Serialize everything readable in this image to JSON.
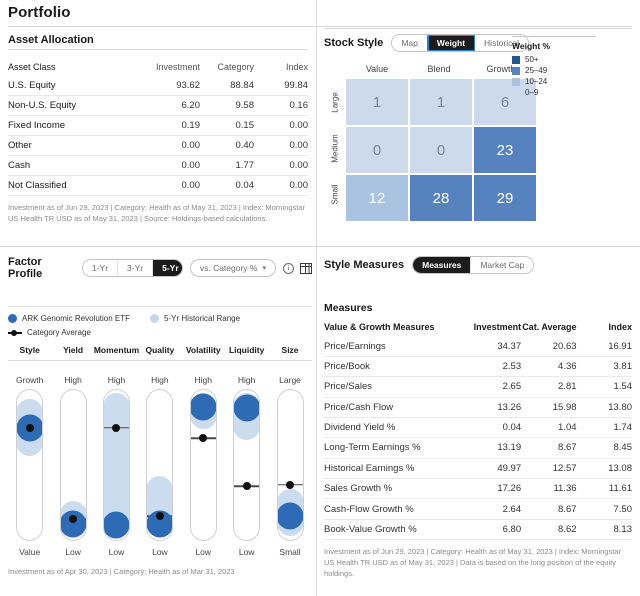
{
  "page": {
    "title": "Portfolio"
  },
  "asset_allocation": {
    "heading": "Asset Allocation",
    "columns": [
      "Asset Class",
      "Investment",
      "Category",
      "Index"
    ],
    "rows": [
      {
        "label": "U.S. Equity",
        "investment": "93.62",
        "category": "88.84",
        "index": "99.84"
      },
      {
        "label": "Non-U.S. Equity",
        "investment": "6.20",
        "category": "9.58",
        "index": "0.16"
      },
      {
        "label": "Fixed Income",
        "investment": "0.19",
        "category": "0.15",
        "index": "0.00"
      },
      {
        "label": "Other",
        "investment": "0.00",
        "category": "0.40",
        "index": "0.00"
      },
      {
        "label": "Cash",
        "investment": "0.00",
        "category": "1.77",
        "index": "0.00"
      },
      {
        "label": "Not Classified",
        "investment": "0.00",
        "category": "0.04",
        "index": "0.00"
      }
    ],
    "footnote": "Investment as of Jun 29, 2023 | Category: Health as of May 31, 2023 | Index: Morningstar US Health TR USD as of May 31, 2023 | Source: Holdings-based calculations."
  },
  "stock_style": {
    "heading": "Stock Style",
    "tabs": [
      {
        "label": "Map",
        "active": false
      },
      {
        "label": "Weight",
        "active": true
      },
      {
        "label": "Historical",
        "active": false
      }
    ],
    "col_headers": [
      "Value",
      "Blend",
      "Growth"
    ],
    "row_headers": [
      "Large",
      "Medium",
      "Small"
    ],
    "cells": [
      [
        {
          "value": "1",
          "band": 0
        },
        {
          "value": "1",
          "band": 0
        },
        {
          "value": "6",
          "band": 0
        }
      ],
      [
        {
          "value": "0",
          "band": 0
        },
        {
          "value": "0",
          "band": 0
        },
        {
          "value": "23",
          "band": 2
        }
      ],
      [
        {
          "value": "12",
          "band": 1
        },
        {
          "value": "28",
          "band": 2
        },
        {
          "value": "29",
          "band": 2
        }
      ]
    ],
    "legend": {
      "title": "Weight %",
      "items": [
        {
          "label": "50+",
          "color": "#23558f"
        },
        {
          "label": "25–49",
          "color": "#5782c0"
        },
        {
          "label": "10–24",
          "color": "#a9c3e0"
        },
        {
          "label": "0–9",
          "color": "#ccdaeb"
        }
      ]
    }
  },
  "factor_profile": {
    "heading": "Factor Profile",
    "period_tabs": [
      {
        "label": "1-Yr",
        "active": false
      },
      {
        "label": "3-Yr",
        "active": false
      },
      {
        "label": "5-Yr",
        "active": true
      }
    ],
    "comparison": {
      "label": "vs. Category %",
      "caret": "⌄"
    },
    "info_icon": "i",
    "legend": [
      {
        "label": "ARK Genomic Revolution ETF",
        "marker": "blue-dot"
      },
      {
        "label": "5-Yr Historical Range",
        "marker": "light-dot"
      },
      {
        "label": "Category Average",
        "marker": "line-dot"
      }
    ],
    "factors": [
      {
        "name": "Style",
        "top": "Growth",
        "bottom": "Value",
        "value_pct": 25,
        "range_top_pct": 6,
        "range_bottom_pct": 44,
        "avg_pct": 25
      },
      {
        "name": "Yield",
        "top": "High",
        "bottom": "Low",
        "value_pct": 89,
        "range_top_pct": 74,
        "range_bottom_pct": 97,
        "avg_pct": 86
      },
      {
        "name": "Momentum",
        "top": "High",
        "bottom": "Low",
        "value_pct": 90,
        "range_top_pct": 2,
        "range_bottom_pct": 98,
        "avg_pct": 25
      },
      {
        "name": "Quality",
        "top": "High",
        "bottom": "Low",
        "value_pct": 89,
        "range_top_pct": 57,
        "range_bottom_pct": 97,
        "avg_pct": 84
      },
      {
        "name": "Volatility",
        "top": "High",
        "bottom": "Low",
        "value_pct": 11,
        "range_top_pct": 2,
        "range_bottom_pct": 26,
        "avg_pct": 32
      },
      {
        "name": "Liquidity",
        "top": "High",
        "bottom": "Low",
        "value_pct": 12,
        "range_top_pct": 2,
        "range_bottom_pct": 33,
        "avg_pct": 64
      },
      {
        "name": "Size",
        "top": "Large",
        "bottom": "Small",
        "value_pct": 84,
        "range_top_pct": 66,
        "range_bottom_pct": 97,
        "avg_pct": 63
      }
    ],
    "footnote": "Investment as of Apr 30, 2023 | Category: Health as of Mar 31, 2023"
  },
  "style_measures": {
    "heading": "Style Measures",
    "tabs": [
      {
        "label": "Measures",
        "active": true
      },
      {
        "label": "Market Cap",
        "active": false
      }
    ],
    "subheading": "Measures",
    "columns": [
      "Value & Growth Measures",
      "Investment",
      "Cat. Average",
      "Index"
    ],
    "rows": [
      {
        "label": "Price/Earnings",
        "investment": "34.37",
        "cat_average": "20.63",
        "index": "16.91"
      },
      {
        "label": "Price/Book",
        "investment": "2.53",
        "cat_average": "4.36",
        "index": "3.81"
      },
      {
        "label": "Price/Sales",
        "investment": "2.65",
        "cat_average": "2.81",
        "index": "1.54"
      },
      {
        "label": "Price/Cash Flow",
        "investment": "13.26",
        "cat_average": "15.98",
        "index": "13.80"
      },
      {
        "label": "Dividend Yield %",
        "investment": "0.04",
        "cat_average": "1.04",
        "index": "1.74"
      },
      {
        "label": "Long-Term Earnings %",
        "investment": "13.19",
        "cat_average": "8.67",
        "index": "8.45"
      },
      {
        "label": "Historical Earnings %",
        "investment": "49.97",
        "cat_average": "12.57",
        "index": "13.08"
      },
      {
        "label": "Sales Growth %",
        "investment": "17.26",
        "cat_average": "11.36",
        "index": "11.61"
      },
      {
        "label": "Cash-Flow Growth %",
        "investment": "2.64",
        "cat_average": "8.67",
        "index": "7.50"
      },
      {
        "label": "Book-Value Growth %",
        "investment": "6.80",
        "cat_average": "8.62",
        "index": "8.13"
      }
    ],
    "footnote": "Investment as of Jun 29, 2023 | Category: Health as of May 31, 2023 | Index: Morningstar US Health TR USD as of May 31, 2023 | Data is based on the long position of the equity holdings."
  }
}
